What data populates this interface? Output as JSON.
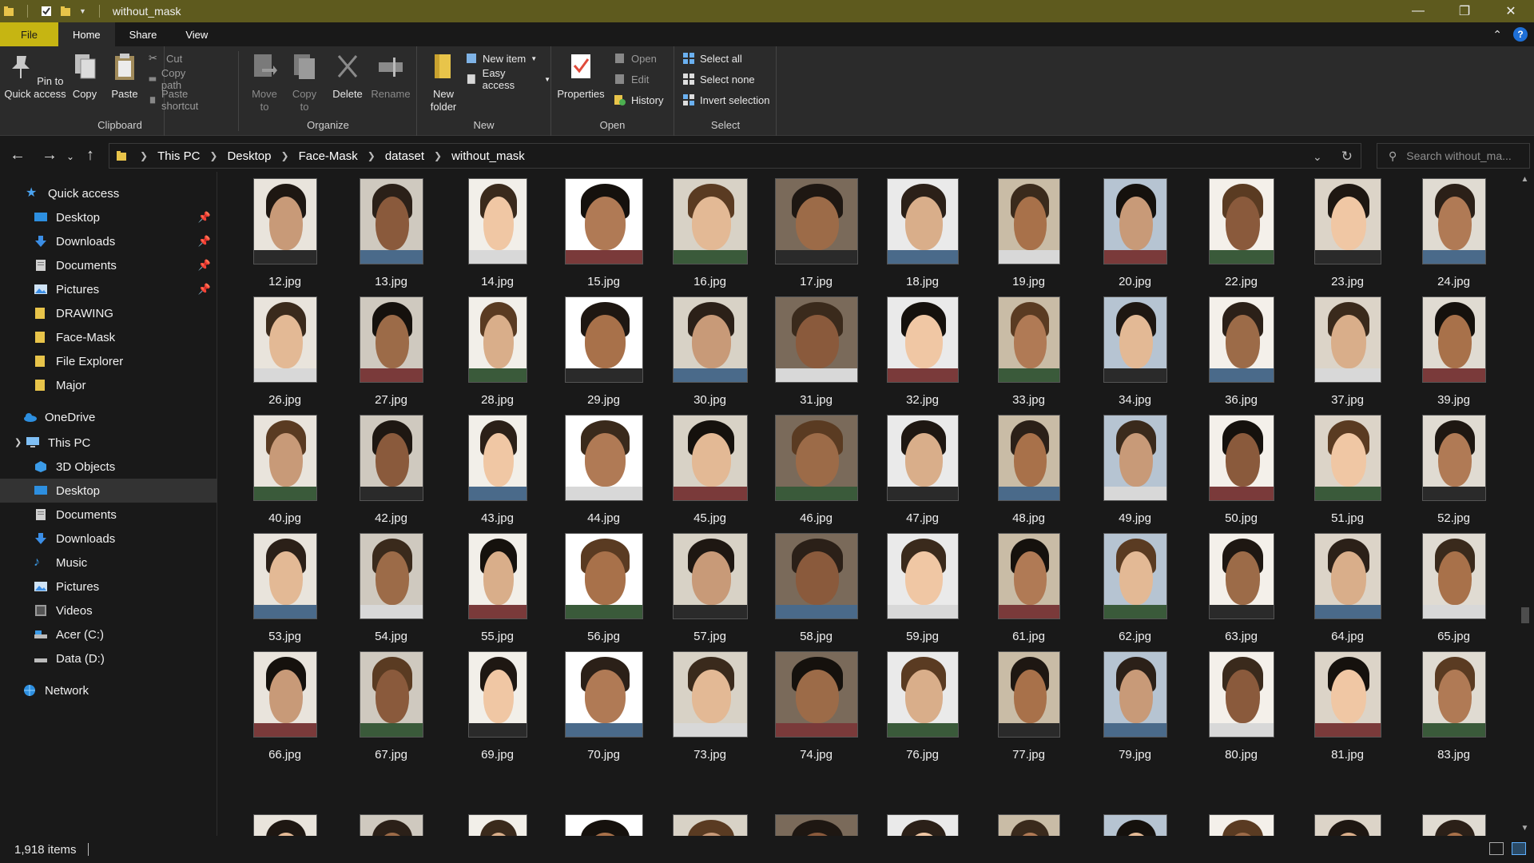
{
  "window": {
    "title": "without_mask",
    "controls": [
      "minimize",
      "restore",
      "close"
    ]
  },
  "ribbon_tabs": [
    "File",
    "Home",
    "Share",
    "View"
  ],
  "ribbon": {
    "clipboard": {
      "label": "Clipboard",
      "pin": "Pin to Quick access",
      "copy": "Copy",
      "paste": "Paste",
      "cut": "Cut",
      "copy_path": "Copy path",
      "paste_shortcut": "Paste shortcut"
    },
    "organize": {
      "label": "Organize",
      "move_to": "Move to",
      "copy_to": "Copy to",
      "delete": "Delete",
      "rename": "Rename"
    },
    "new": {
      "label": "New",
      "new_folder": "New folder",
      "new_item": "New item",
      "easy_access": "Easy access"
    },
    "open": {
      "label": "Open",
      "properties": "Properties",
      "open": "Open",
      "edit": "Edit",
      "history": "History"
    },
    "select": {
      "label": "Select",
      "select_all": "Select all",
      "select_none": "Select none",
      "invert": "Invert selection"
    }
  },
  "address": {
    "crumbs": [
      "This PC",
      "Desktop",
      "Face-Mask",
      "dataset",
      "without_mask"
    ],
    "search_placeholder": "Search without_ma..."
  },
  "sidebar": {
    "quick_access": "Quick access",
    "quick_items": [
      {
        "label": "Desktop",
        "icon": "desktop-icon",
        "pinned": true
      },
      {
        "label": "Downloads",
        "icon": "download-icon",
        "pinned": true
      },
      {
        "label": "Documents",
        "icon": "document-icon",
        "pinned": true
      },
      {
        "label": "Pictures",
        "icon": "pictures-icon",
        "pinned": true
      },
      {
        "label": "DRAWING",
        "icon": "folder-icon",
        "pinned": false
      },
      {
        "label": "Face-Mask",
        "icon": "folder-icon",
        "pinned": false
      },
      {
        "label": "File Explorer",
        "icon": "folder-icon",
        "pinned": false
      },
      {
        "label": "Major",
        "icon": "folder-icon",
        "pinned": false
      }
    ],
    "onedrive": "OneDrive",
    "this_pc": "This PC",
    "pc_items": [
      {
        "label": "3D Objects",
        "icon": "cube-icon"
      },
      {
        "label": "Desktop",
        "icon": "desktop-icon",
        "selected": true
      },
      {
        "label": "Documents",
        "icon": "document-icon"
      },
      {
        "label": "Downloads",
        "icon": "download-icon"
      },
      {
        "label": "Music",
        "icon": "music-icon"
      },
      {
        "label": "Pictures",
        "icon": "pictures-icon"
      },
      {
        "label": "Videos",
        "icon": "video-icon"
      },
      {
        "label": "Acer (C:)",
        "icon": "drive-icon"
      },
      {
        "label": "Data (D:)",
        "icon": "drive-icon"
      }
    ],
    "network": "Network"
  },
  "files": [
    [
      "12.jpg",
      "13.jpg",
      "14.jpg",
      "15.jpg",
      "16.jpg",
      "17.jpg",
      "18.jpg",
      "19.jpg",
      "20.jpg",
      "22.jpg",
      "23.jpg",
      "24.jpg"
    ],
    [
      "26.jpg",
      "27.jpg",
      "28.jpg",
      "29.jpg",
      "30.jpg",
      "31.jpg",
      "32.jpg",
      "33.jpg",
      "34.jpg",
      "36.jpg",
      "37.jpg",
      "39.jpg"
    ],
    [
      "40.jpg",
      "42.jpg",
      "43.jpg",
      "44.jpg",
      "45.jpg",
      "46.jpg",
      "47.jpg",
      "48.jpg",
      "49.jpg",
      "50.jpg",
      "51.jpg",
      "52.jpg"
    ],
    [
      "53.jpg",
      "54.jpg",
      "55.jpg",
      "56.jpg",
      "57.jpg",
      "58.jpg",
      "59.jpg",
      "61.jpg",
      "62.jpg",
      "63.jpg",
      "64.jpg",
      "65.jpg"
    ],
    [
      "66.jpg",
      "67.jpg",
      "69.jpg",
      "70.jpg",
      "73.jpg",
      "74.jpg",
      "76.jpg",
      "77.jpg",
      "79.jpg",
      "80.jpg",
      "81.jpg",
      "83.jpg"
    ],
    [
      "",
      "",
      "",
      "",
      "",
      "",
      "",
      "",
      "",
      "",
      "",
      ""
    ]
  ],
  "status": {
    "count": "1,918 items"
  },
  "colors": {
    "titlebar": "#5e5a1e",
    "file_tab": "#c6b512",
    "background": "#191919",
    "ribbon": "#2b2b2b"
  }
}
